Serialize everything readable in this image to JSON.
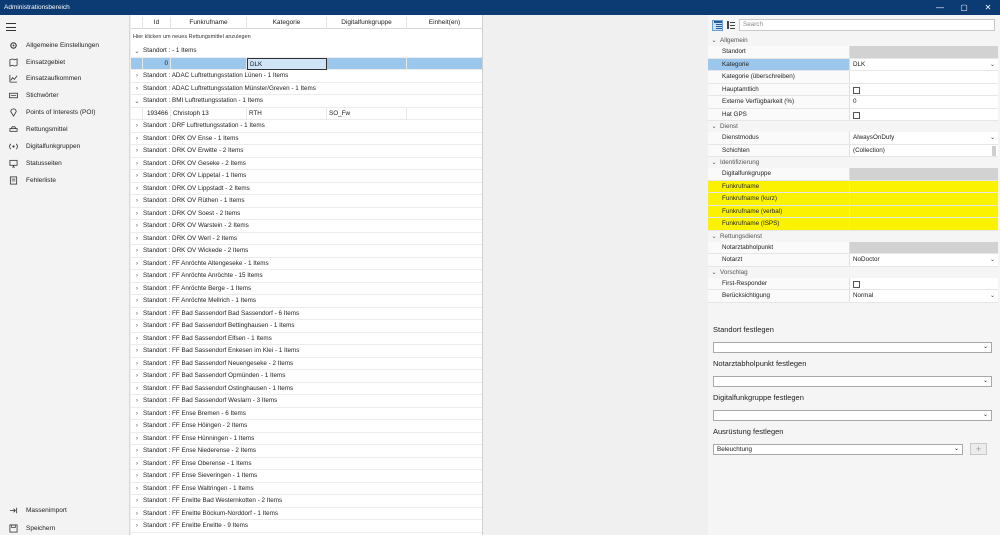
{
  "window": {
    "title": "Administrationsbereich",
    "controls": [
      "—",
      "▢",
      "✕"
    ]
  },
  "sidebar": {
    "items": [
      {
        "label": "Allgemeine Einstellungen",
        "icon": "gear-icon"
      },
      {
        "label": "Einsatzgebiet",
        "icon": "map-icon"
      },
      {
        "label": "Einsatzaufkommen",
        "icon": "chart-icon"
      },
      {
        "label": "Stichwörter",
        "icon": "keyboard-icon"
      },
      {
        "label": "Points of Interests (POI)",
        "icon": "pin-icon"
      },
      {
        "label": "Rettungsmittel",
        "icon": "car-icon"
      },
      {
        "label": "Digitalfunkgruppen",
        "icon": "radio-icon"
      },
      {
        "label": "Statusseiten",
        "icon": "monitor-icon"
      },
      {
        "label": "Fehlerliste",
        "icon": "error-list-icon"
      }
    ],
    "bottom_items": [
      {
        "label": "Massenimport",
        "icon": "import-icon"
      },
      {
        "label": "Speichern",
        "icon": "save-icon"
      }
    ]
  },
  "grid": {
    "columns": [
      "Id",
      "Funkrufname",
      "Kategorie",
      "Digitalfunkgruppe",
      "Einheit(en)"
    ],
    "new_hint": "Hier klicken um neues Rettungsmittel anzulegen",
    "rows": [
      {
        "type": "group",
        "label": "Standort :  - 1 Items",
        "expanded": true
      },
      {
        "type": "data",
        "id": "0",
        "name": "",
        "cat": "DLK",
        "dfg": "",
        "units": "",
        "selected": true
      },
      {
        "type": "group",
        "label": "Standort : ADAC Luftrettungsstation Lünen - 1 Items",
        "expanded": false
      },
      {
        "type": "group",
        "label": "Standort : ADAC Luftrettungsstation Münster/Greven - 1 Items",
        "expanded": false
      },
      {
        "type": "group",
        "label": "Standort : BMI Luftrettungsstation - 1 Items",
        "expanded": true
      },
      {
        "type": "data",
        "id": "193466",
        "name": "Christoph 13",
        "cat": "RTH",
        "dfg": "SO_Fw",
        "units": "",
        "selected": false
      },
      {
        "type": "group",
        "label": "Standort : DRF Luftrettungsstation - 1 Items",
        "expanded": false
      },
      {
        "type": "group",
        "label": "Standort : DRK OV Ense - 1 Items",
        "expanded": false
      },
      {
        "type": "group",
        "label": "Standort : DRK OV Erwitte - 2 Items",
        "expanded": false
      },
      {
        "type": "group",
        "label": "Standort : DRK OV Geseke - 2 Items",
        "expanded": false
      },
      {
        "type": "group",
        "label": "Standort : DRK OV Lippetal - 1 Items",
        "expanded": false
      },
      {
        "type": "group",
        "label": "Standort : DRK OV Lippstadt - 2 Items",
        "expanded": false
      },
      {
        "type": "group",
        "label": "Standort : DRK OV Rüthen - 1 Items",
        "expanded": false
      },
      {
        "type": "group",
        "label": "Standort : DRK OV Soest - 2 Items",
        "expanded": false
      },
      {
        "type": "group",
        "label": "Standort : DRK OV Warstein - 2 Items",
        "expanded": false
      },
      {
        "type": "group",
        "label": "Standort : DRK OV Werl - 2 Items",
        "expanded": false
      },
      {
        "type": "group",
        "label": "Standort : DRK OV Wickede - 2 Items",
        "expanded": false
      },
      {
        "type": "group",
        "label": "Standort : FF Anröchte Altengeseke - 1 Items",
        "expanded": false
      },
      {
        "type": "group",
        "label": "Standort : FF Anröchte Anröchte - 15 Items",
        "expanded": false
      },
      {
        "type": "group",
        "label": "Standort : FF Anröchte Berge - 1 Items",
        "expanded": false
      },
      {
        "type": "group",
        "label": "Standort : FF Anröchte Mellrich - 1 Items",
        "expanded": false
      },
      {
        "type": "group",
        "label": "Standort : FF Bad Sassendorf Bad Sassendorf - 6 Items",
        "expanded": false
      },
      {
        "type": "group",
        "label": "Standort : FF Bad Sassendorf Bettinghausen - 1 Items",
        "expanded": false
      },
      {
        "type": "group",
        "label": "Standort : FF Bad Sassendorf Elfsen - 1 Items",
        "expanded": false
      },
      {
        "type": "group",
        "label": "Standort : FF Bad Sassendorf Enkesen im Klei - 1 Items",
        "expanded": false
      },
      {
        "type": "group",
        "label": "Standort : FF Bad Sassendorf Neuengeseke - 2 Items",
        "expanded": false
      },
      {
        "type": "group",
        "label": "Standort : FF Bad Sassendorf Opmünden - 1 Items",
        "expanded": false
      },
      {
        "type": "group",
        "label": "Standort : FF Bad Sassendorf Ostinghausen - 1 Items",
        "expanded": false
      },
      {
        "type": "group",
        "label": "Standort : FF Bad Sassendorf Weslarn - 3 Items",
        "expanded": false
      },
      {
        "type": "group",
        "label": "Standort : FF Ense Bremen - 6 Items",
        "expanded": false
      },
      {
        "type": "group",
        "label": "Standort : FF Ense Höingen - 2 Items",
        "expanded": false
      },
      {
        "type": "group",
        "label": "Standort : FF Ense Hünningen - 1 Items",
        "expanded": false
      },
      {
        "type": "group",
        "label": "Standort : FF Ense Niederense - 2 Items",
        "expanded": false
      },
      {
        "type": "group",
        "label": "Standort : FF Ense Oberense - 1 Items",
        "expanded": false
      },
      {
        "type": "group",
        "label": "Standort : FF Ense Sieveringen - 1 Items",
        "expanded": false
      },
      {
        "type": "group",
        "label": "Standort : FF Ense Waltringen - 1 Items",
        "expanded": false
      },
      {
        "type": "group",
        "label": "Standort : FF Erwitte Bad Westernkotten - 2 Items",
        "expanded": false
      },
      {
        "type": "group",
        "label": "Standort : FF Erwitte Böckum-Norddorf - 1 Items",
        "expanded": false
      },
      {
        "type": "group",
        "label": "Standort : FF Erwitte Erwitte - 9 Items",
        "expanded": false
      }
    ]
  },
  "props": {
    "search_placeholder": "Search",
    "entries": [
      {
        "kind": "cat",
        "label": "Allgemein"
      },
      {
        "kind": "prop",
        "name": "Standort",
        "value": "",
        "grey": true
      },
      {
        "kind": "prop",
        "name": "Kategorie",
        "value": "DLK",
        "dropdown": true,
        "selected": true
      },
      {
        "kind": "prop",
        "name": "Kategorie (überschreiben)",
        "value": ""
      },
      {
        "kind": "prop",
        "name": "Hauptamtlich",
        "check": true
      },
      {
        "kind": "prop",
        "name": "Externe Verfügbarkeit (%)",
        "value": "0"
      },
      {
        "kind": "prop",
        "name": "Hat GPS",
        "check": true
      },
      {
        "kind": "cat",
        "label": "Dienst"
      },
      {
        "kind": "prop",
        "name": "Dienstmodus",
        "value": "AlwaysOnDuty",
        "dropdown": true
      },
      {
        "kind": "prop",
        "name": "Schichten",
        "value": "(Collection)",
        "scroll": true
      },
      {
        "kind": "cat",
        "label": "Identifizierung"
      },
      {
        "kind": "prop",
        "name": "Digitalfunkgruppe",
        "value": "",
        "grey": true
      },
      {
        "kind": "prop",
        "name": "Funkrufname",
        "value": "",
        "highlight": true
      },
      {
        "kind": "prop",
        "name": "Funkrufname (kurz)",
        "value": "",
        "highlight": true
      },
      {
        "kind": "prop",
        "name": "Funkrufname (verbal)",
        "value": "",
        "highlight": true
      },
      {
        "kind": "prop",
        "name": "Funkrufname (ISPS)",
        "value": "",
        "highlight": true
      },
      {
        "kind": "cat",
        "label": "Rettungsdienst"
      },
      {
        "kind": "prop",
        "name": "Notarztabholpunkt",
        "value": "",
        "grey": true
      },
      {
        "kind": "prop",
        "name": "Notarzt",
        "value": "NoDoctor",
        "dropdown": true
      },
      {
        "kind": "cat",
        "label": "Vorschlag"
      },
      {
        "kind": "prop",
        "name": "First-Responder",
        "check": true
      },
      {
        "kind": "prop",
        "name": "Berücksichtigung",
        "value": "Normal",
        "dropdown": true
      }
    ]
  },
  "sections": {
    "standort": {
      "title": "Standort festlegen",
      "value": ""
    },
    "notarzt": {
      "title": "Notarztabholpunkt festlegen",
      "value": ""
    },
    "digitalfunk": {
      "title": "Digitalfunkgruppe festlegen",
      "value": ""
    },
    "ausruestung": {
      "title": "Ausrüstung festlegen",
      "value": "Beleuchtung",
      "add_label": "+"
    }
  }
}
